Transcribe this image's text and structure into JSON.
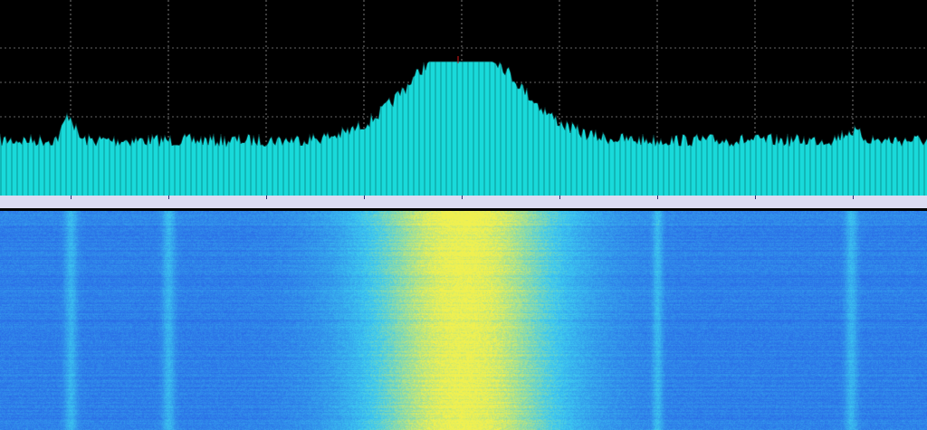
{
  "spectrum": {
    "trace_color": "#19dada",
    "trace_shadow_color": "#0a8c8c",
    "grid_color": "#c8c8c8",
    "background_color": "#000000",
    "peak_center_fraction": 0.5,
    "noise_floor_fraction": 0.27
  },
  "marker": {
    "line1": "",
    "line2": ""
  },
  "frequency_axis": {
    "edge_label": "",
    "labels": [
      "",
      "",
      "",
      "",
      "",
      "",
      "",
      "",
      ""
    ]
  },
  "waterfall": {
    "time_labels": [
      "",
      "",
      "",
      "",
      "",
      "",
      "",
      "",
      "",
      "",
      ""
    ],
    "low_color": "#2a6ce6",
    "mid_color": "#3cc8f0",
    "high_color": "#f0f050",
    "signal_center_fraction": 0.5,
    "signal_width_fraction": 0.14
  }
}
